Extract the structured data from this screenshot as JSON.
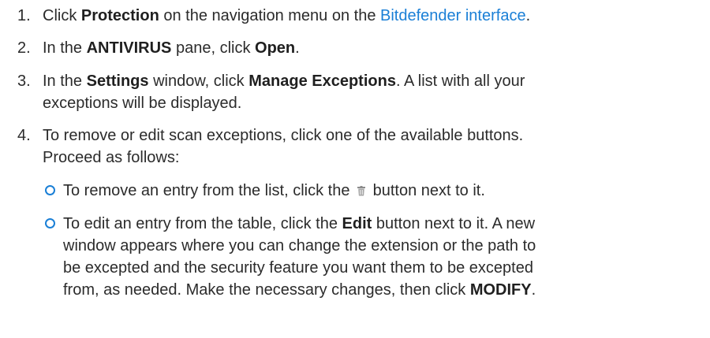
{
  "steps": [
    {
      "number": "1.",
      "lines": [
        {
          "t1": "Click ",
          "b1": "Protection",
          "t2": " on the navigation menu on the ",
          "link": "Bitdefender interface",
          "t3": "."
        }
      ]
    },
    {
      "number": "2.",
      "lines": [
        {
          "t1": "In the ",
          "b1": "ANTIVIRUS",
          "t2": " pane, click ",
          "b2": "Open",
          "t3": "."
        }
      ]
    },
    {
      "number": "3.",
      "lines": [
        {
          "t1": "In the ",
          "b1": "Settings",
          "t2": " window, click ",
          "b2": "Manage Exceptions",
          "t3": ". A list with all your"
        },
        {
          "t1": "exceptions will be displayed."
        }
      ]
    },
    {
      "number": "4.",
      "lines": [
        {
          "t1": "To remove or edit scan exceptions, click one of the available buttons."
        },
        {
          "t1": "Proceed as follows:"
        }
      ]
    }
  ],
  "bullets": [
    {
      "lines": [
        {
          "t1": "To remove an entry from the list, click the ",
          "icon": "trash-icon",
          "t2": " button next to it."
        }
      ]
    },
    {
      "lines": [
        {
          "t1": "To edit an entry from the table, click the ",
          "b1": "Edit",
          "t2": " button next to it. A new"
        },
        {
          "t1": "window appears where you can change the extension or the path to"
        },
        {
          "t1": "be excepted and the security feature you want them to be excepted"
        },
        {
          "t1": "from, as needed. Make the necessary changes, then click ",
          "b1": "MODIFY",
          "t2": "."
        }
      ]
    }
  ],
  "colors": {
    "link": "#1a7fd6",
    "text": "#2b2b2b"
  }
}
